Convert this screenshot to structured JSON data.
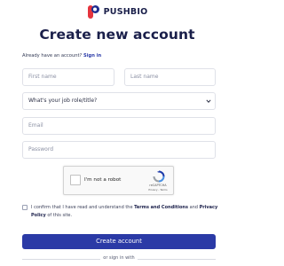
{
  "brand": {
    "name": "PUSHBIO"
  },
  "page": {
    "title": "Create new account"
  },
  "signin_prompt": {
    "text": "Already have an account?",
    "link": "Sign in"
  },
  "form": {
    "first_name": {
      "placeholder": "First name"
    },
    "last_name": {
      "placeholder": "Last name"
    },
    "job_role": {
      "selected": "What's your job role/title?"
    },
    "email": {
      "placeholder": "Email"
    },
    "password": {
      "placeholder": "Password"
    }
  },
  "captcha": {
    "label": "I'm not a robot",
    "brand": "reCAPTCHA",
    "links": "Privacy - Terms"
  },
  "agreement": {
    "prefix": "I confirm that I have read and understand the",
    "terms": "Terms and Conditions",
    "and": "and",
    "privacy": "Privacy",
    "policy": "Policy",
    "suffix": "of this site."
  },
  "actions": {
    "create_label": "Create account",
    "divider_text": "or sign in with"
  },
  "colors": {
    "primary": "#2b3aa6",
    "brand_navy": "#1a1f4a",
    "brand_red": "#e5343d"
  }
}
